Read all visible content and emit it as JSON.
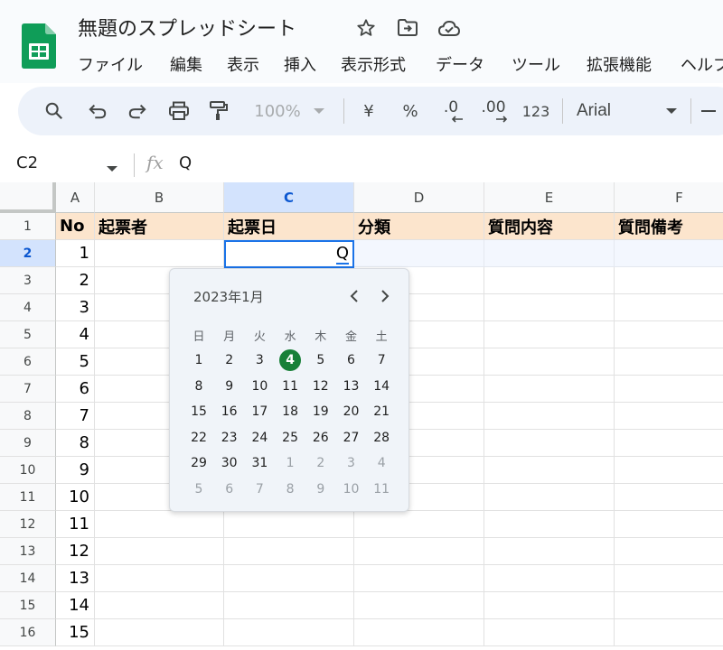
{
  "header": {
    "doc_title": "無題のスプレッドシート",
    "menu": [
      "ファイル",
      "編集",
      "表示",
      "挿入",
      "表示形式",
      "データ",
      "ツール",
      "拡張機能",
      "ヘルプ"
    ]
  },
  "toolbar": {
    "zoom": "100%",
    "currency": "¥",
    "percent": "%",
    "decrease_decimal": ".0",
    "increase_decimal": ".00",
    "number_format": "123",
    "font": "Arial"
  },
  "formula_bar": {
    "name_box": "C2",
    "fx": "fx",
    "value": "Q"
  },
  "grid": {
    "columns": [
      "A",
      "B",
      "C",
      "D",
      "E",
      "F"
    ],
    "selected_column": "C",
    "selected_row": 2,
    "header_row": [
      "No",
      "起票者",
      "起票日",
      "分類",
      "質問内容",
      "質問備考"
    ],
    "row_numbers": [
      "1",
      "2",
      "3",
      "4",
      "5",
      "6",
      "7",
      "8",
      "9",
      "10",
      "11",
      "12",
      "13",
      "14",
      "15",
      "16"
    ],
    "col_a_values": [
      "1",
      "2",
      "3",
      "4",
      "5",
      "6",
      "7",
      "8",
      "9",
      "10",
      "11",
      "12",
      "13",
      "14",
      "15"
    ],
    "active_cell_value": "Q"
  },
  "date_picker": {
    "month_label": "2023年1月",
    "weekdays": [
      "日",
      "月",
      "火",
      "水",
      "木",
      "金",
      "土"
    ],
    "selected_day": "4",
    "weeks": [
      [
        {
          "d": "1"
        },
        {
          "d": "2"
        },
        {
          "d": "3"
        },
        {
          "d": "4"
        },
        {
          "d": "5"
        },
        {
          "d": "6"
        },
        {
          "d": "7"
        }
      ],
      [
        {
          "d": "8"
        },
        {
          "d": "9"
        },
        {
          "d": "10"
        },
        {
          "d": "11"
        },
        {
          "d": "12"
        },
        {
          "d": "13"
        },
        {
          "d": "14"
        }
      ],
      [
        {
          "d": "15"
        },
        {
          "d": "16"
        },
        {
          "d": "17"
        },
        {
          "d": "18"
        },
        {
          "d": "19"
        },
        {
          "d": "20"
        },
        {
          "d": "21"
        }
      ],
      [
        {
          "d": "22"
        },
        {
          "d": "23"
        },
        {
          "d": "24"
        },
        {
          "d": "25"
        },
        {
          "d": "26"
        },
        {
          "d": "27"
        },
        {
          "d": "28"
        }
      ],
      [
        {
          "d": "29"
        },
        {
          "d": "30"
        },
        {
          "d": "31"
        },
        {
          "d": "1",
          "other": true
        },
        {
          "d": "2",
          "other": true
        },
        {
          "d": "3",
          "other": true
        },
        {
          "d": "4",
          "other": true
        }
      ],
      [
        {
          "d": "5",
          "other": true
        },
        {
          "d": "6",
          "other": true
        },
        {
          "d": "7",
          "other": true
        },
        {
          "d": "8",
          "other": true
        },
        {
          "d": "9",
          "other": true
        },
        {
          "d": "10",
          "other": true
        },
        {
          "d": "11",
          "other": true
        }
      ]
    ]
  },
  "icons": {
    "app": "sheets-logo-icon",
    "star": "star-icon",
    "move": "move-to-folder-icon",
    "cloud": "cloud-saved-icon",
    "search": "search-icon",
    "undo": "undo-icon",
    "redo": "redo-icon",
    "print": "print-icon",
    "paint": "paint-format-icon"
  },
  "colors": {
    "header_fill": "#fce5cd",
    "selection": "#1a73e8",
    "selected_day": "#188038",
    "toolbar_bg": "#edf2fa"
  }
}
